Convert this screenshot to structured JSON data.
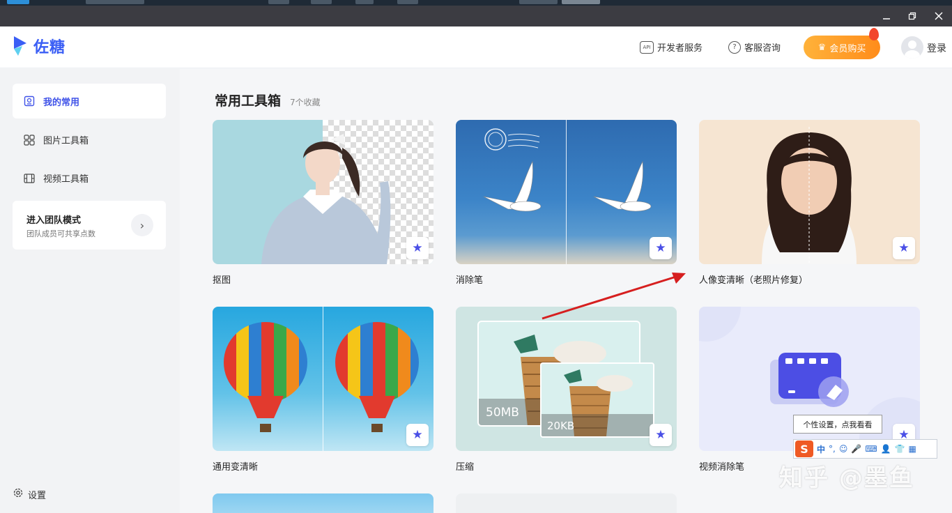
{
  "window": {
    "minimize_icon": "minimize-icon",
    "restore_icon": "restore-icon",
    "close_icon": "close-icon"
  },
  "header": {
    "app_name": "佐糖",
    "developer_service": "开发者服务",
    "customer_service": "客服咨询",
    "vip_label": "会员购买",
    "login": "登录"
  },
  "sidebar": {
    "items": [
      {
        "label": "我的常用",
        "icon": "favorites-icon",
        "active": true
      },
      {
        "label": "图片工具箱",
        "icon": "grid-icon",
        "active": false
      },
      {
        "label": "视频工具箱",
        "icon": "film-icon",
        "active": false
      }
    ],
    "team": {
      "title": "进入团队模式",
      "subtitle": "团队成员可共享点数"
    },
    "settings": "设置"
  },
  "main": {
    "title": "常用工具箱",
    "count": "7个收藏",
    "cards": [
      {
        "label": "抠图"
      },
      {
        "label": "消除笔"
      },
      {
        "label": "人像变清晰（老照片修复）"
      },
      {
        "label": "通用变清晰"
      },
      {
        "label": "压缩",
        "size_before": "50MB",
        "size_after": "20KB"
      },
      {
        "label": "视频消除笔"
      }
    ]
  },
  "ime": {
    "tip": "个性设置，点我看看",
    "logo": "S",
    "mode": "中"
  },
  "watermark": "知乎 @墨鱼",
  "colors": {
    "accent": "#4053e8",
    "vip": "#ff9a24",
    "annotation_arrow": "#d61f1f"
  }
}
